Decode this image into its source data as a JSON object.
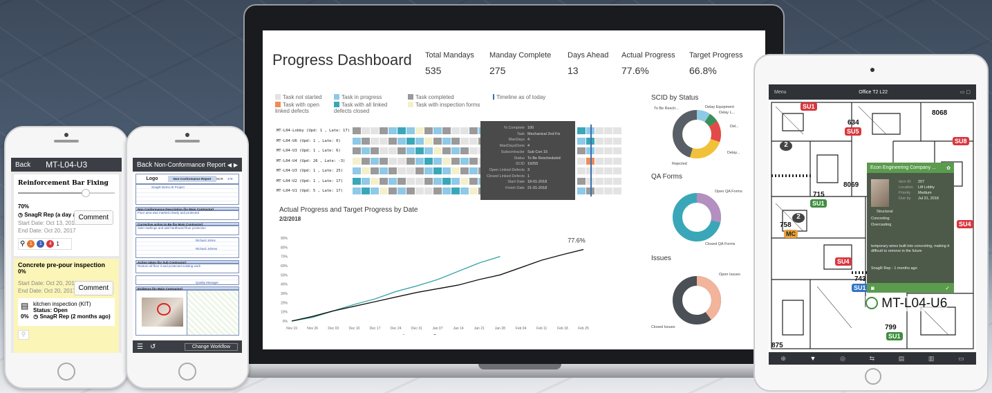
{
  "dashboard": {
    "title": "Progress Dashboard",
    "kpis": [
      {
        "label": "Total Mandays",
        "value": "535"
      },
      {
        "label": "Manday Complete",
        "value": "275"
      },
      {
        "label": "Days Ahead",
        "value": "13"
      },
      {
        "label": "Actual Progress",
        "value": "77.6%"
      },
      {
        "label": "Target Progress",
        "value": "66.8%"
      }
    ],
    "legend": [
      {
        "label": "Task not started",
        "color": "#e3e3e3"
      },
      {
        "label": "Task in progress",
        "color": "#8ec9e8"
      },
      {
        "label": "Task completed",
        "color": "#9a9a9a"
      },
      {
        "label": "Timeline as of today",
        "color": "#3a6fa8"
      },
      {
        "label": "Task with open linked defects",
        "color": "#f08a5a"
      },
      {
        "label": "Task with all linked defects closed",
        "color": "#3aa7b8"
      },
      {
        "label": "Task with inspection forms",
        "color": "#f4f0cc"
      }
    ],
    "gantt_rows": [
      "MT-L04-Lobby (Upd: 1 , Late: 17)",
      "MT-L04-U6 (Upd: 1 , Late: 0)",
      "MT-L04-U3 (Upd: 1 , Late: 6)",
      "MT-L04-U4 (Upd: 26 , Late: -3)",
      "MT-L04-U3 (Upd: 1 , Late: 25)",
      "MT-L04-U2 (Upd: 1 , Late: 17)",
      "MT-L04-U1 (Upd: 5 , Late: 17)"
    ],
    "tooltip": [
      {
        "k": "% Complete",
        "v": "100"
      },
      {
        "k": "Task",
        "v": "Mechanical 2nd Fix"
      },
      {
        "k": "ManDays",
        "v": "4"
      },
      {
        "k": "ManDaysDone",
        "v": "4"
      },
      {
        "k": "Subcontractor",
        "v": "Sub Con 15"
      },
      {
        "k": "Status",
        "v": "To Be Rescheduled"
      },
      {
        "k": "SCID",
        "v": "19255"
      },
      {
        "k": "Open Linked Defects",
        "v": "3"
      },
      {
        "k": "Closed Linked Defects",
        "v": "1"
      },
      {
        "k": "Start Date",
        "v": "18-01-2018"
      },
      {
        "k": "Finish Date",
        "v": "21-01-2018"
      }
    ],
    "progress_chart_title": "Actual Progress and Target Progress by Date",
    "progress_chart_date": "2/2/2018",
    "progress_end_value": "77.6%",
    "donuts": [
      {
        "title": "SCID by Status",
        "labels": [
          "To Be Resch...",
          "Delay Equipment",
          "Delay L...",
          "Del...",
          "Delay...",
          "Rejected"
        ]
      },
      {
        "title": "QA Forms",
        "labels": [
          "Open QA Forms",
          "Closed QA Forms"
        ]
      },
      {
        "title": "Issues",
        "labels": [
          "Open Issues",
          "Closed Issues"
        ]
      }
    ]
  },
  "chart_data": {
    "type": "line",
    "title": "Actual Progress and Target Progress by Date",
    "x": [
      "Nov 19",
      "Nov 26",
      "Dec 03",
      "Dec 10",
      "Dec 17",
      "Dec 24",
      "Dec 31",
      "Jan 07",
      "Jan 14",
      "Jan 21",
      "Jan 28",
      "Feb 04",
      "Feb 11",
      "Feb 18",
      "Feb 25"
    ],
    "y_ticks": [
      "0%",
      "10%",
      "20%",
      "30%",
      "40%",
      "50%",
      "60%",
      "70%",
      "80%",
      "90%"
    ],
    "ylim": [
      0,
      90
    ],
    "series": [
      {
        "name": "Actual Progress",
        "color": "#3aa7a5",
        "values": [
          0,
          4,
          11,
          18,
          24,
          32,
          38,
          45,
          54,
          63,
          70,
          null,
          null,
          null,
          null
        ]
      },
      {
        "name": "Target Progress",
        "color": "#111111",
        "values": [
          0,
          5,
          11,
          16,
          21,
          26,
          31,
          35,
          39,
          45,
          50,
          58,
          66,
          72,
          77.6
        ]
      }
    ],
    "legend_placement": "bottom"
  },
  "phone1": {
    "back": "Back",
    "title": "MT-L04-U3",
    "card1_title": "Reinforcement Bar Fixing",
    "card1_progress": "70%",
    "card1_user": "SnagR Rep (a day ago)",
    "card1_start": "Start Date: Oct 13, 2017",
    "card1_end": "End Date: Oct 20, 2017",
    "comment": "Comment",
    "badges": [
      "1",
      "1",
      "4",
      "1"
    ],
    "card2_title": "Concrete pre-pour inspection",
    "card2_progress": "0%",
    "card2_start": "Start Date: Oct 20, 2017",
    "card2_end": "End Date: Oct 20, 2017",
    "form_name": "kitchen inspection (KIT)",
    "form_status": "Status: Open",
    "form_pct": "0%",
    "form_user": "SnagR Rep (2 months ago)"
  },
  "phone2": {
    "back": "Back",
    "title": "Non-Conformance Report",
    "logo": "Logo",
    "report_title": "Non-Conformance Report",
    "ncr": "NCR",
    "ncr_no": "478",
    "project": "SnagR Demo IE Project",
    "section1": "Non Conformance Description (by Main Contractor)",
    "section1_text": "Floor area was marked clearly and protected",
    "section2": "Corrective action to Be (by Main Contractor)",
    "section2_text": "Side markings and add hardboard floor protection",
    "section3": "Action taken (by Sub Contractor)",
    "section3_text": "Restore all floor it and protected existing work",
    "signer1": "Richard Johns",
    "signer2": "Richard Johnes",
    "role": "Quality Manager",
    "evidence": "Evidence (by Main Contractor)",
    "workflow": "Change Workflow"
  },
  "tablet": {
    "menu": "Menu",
    "title": "Office T2 L22",
    "unit_label": "MT-L04-U6",
    "pins": [
      "SU1",
      "SU5",
      "SU8",
      "SU1",
      "MC",
      "SU4",
      "SU1",
      "SU4",
      "SU1"
    ],
    "numbers": [
      "8068",
      "634",
      "2",
      "715",
      "8069",
      "758",
      "2",
      "743",
      "799",
      "875"
    ],
    "popup_title": "Econ Engineering Company ...",
    "popup_rows": [
      {
        "k": "Item ID",
        "v": "207"
      },
      {
        "k": "Location",
        "v": "Lift Lobby"
      },
      {
        "k": "Priority",
        "v": "Medium"
      },
      {
        "k": "Due by",
        "v": "Jul 31, 2018"
      }
    ],
    "popup_category": "Structural",
    "popup_sub1": "Concreting",
    "popup_sub2": "Overcasting",
    "popup_desc": "temporary wires built into concreting, making it difficult to remove in the future",
    "popup_user": "SnagR Rep - 1 months ago"
  }
}
